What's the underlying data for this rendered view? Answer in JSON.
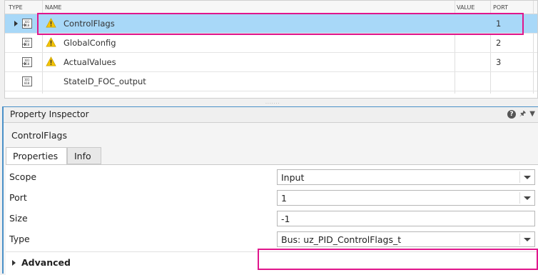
{
  "table": {
    "columns": [
      "TYPE",
      "NAME",
      "VALUE",
      "PORT"
    ],
    "rows": [
      {
        "name": "ControlFlags",
        "port": "1",
        "selected": true,
        "warning": true,
        "type_icon": "bus-inport-icon"
      },
      {
        "name": "GlobalConfig",
        "port": "2",
        "selected": false,
        "warning": true,
        "type_icon": "bus-inport-icon"
      },
      {
        "name": "ActualValues",
        "port": "3",
        "selected": false,
        "warning": true,
        "type_icon": "bus-inport-icon"
      },
      {
        "name": "StateID_FOC_output",
        "port": "",
        "selected": false,
        "warning": false,
        "type_icon": "signal-output-icon"
      }
    ]
  },
  "inspector": {
    "title": "Property Inspector",
    "block_name": "ControlFlags",
    "tabs": [
      "Properties",
      "Info"
    ],
    "active_tab": "Properties",
    "properties": {
      "scope": {
        "label": "Scope",
        "value": "Input"
      },
      "port": {
        "label": "Port",
        "value": "1"
      },
      "size": {
        "label": "Size",
        "value": "-1"
      },
      "type": {
        "label": "Type",
        "value": "Bus: uz_PID_ControlFlags_t"
      }
    },
    "advanced_label": "Advanced"
  },
  "colors": {
    "selection": "#a8d8f8",
    "highlight": "#e0168c",
    "warning": "#f5c400",
    "inspector_border": "#4a90c8"
  }
}
